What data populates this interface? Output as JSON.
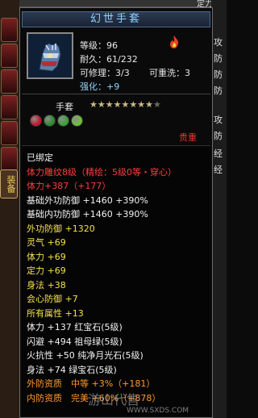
{
  "background": {
    "top_partial": "定力",
    "right_labels": [
      "攻",
      "防",
      "防",
      "防",
      "攻",
      "防",
      "经",
      "经"
    ]
  },
  "equip_tab_label": "装备",
  "item": {
    "name": "幻世手套",
    "level": "等级：96",
    "durability": "耐久：61/232",
    "repair": "可修理：3/3",
    "rewash": "可重洗：3",
    "enhance": "强化：+9",
    "type": "手套",
    "stars_total": 9,
    "stars_lit": 8,
    "gem_colors": [
      "#c4182a",
      "#2e8a2e",
      "#3aa03a",
      "#6bc03a"
    ],
    "precious": "贵重"
  },
  "stats": [
    {
      "text": "已绑定",
      "color": "c-white"
    },
    {
      "text": "体力雕纹8级（精绘：5级0等・穿心）",
      "color": "c-red"
    },
    {
      "text": "体力+387（+177）",
      "color": "c-red"
    },
    {
      "text": "基础外功防御 +1460 +390%",
      "color": "c-white"
    },
    {
      "text": "基础内功防御 +1460 +390%",
      "color": "c-white"
    },
    {
      "text": "外功防御 +1320",
      "color": "c-yellow"
    },
    {
      "text": "灵气 +69",
      "color": "c-yellow"
    },
    {
      "text": "体力 +69",
      "color": "c-yellow"
    },
    {
      "text": "定力 +69",
      "color": "c-yellow"
    },
    {
      "text": "身法 +38",
      "color": "c-yellow"
    },
    {
      "text": "会心防御 +7",
      "color": "c-yellow"
    },
    {
      "text": "所有属性 +13",
      "color": "c-yellow"
    },
    {
      "text": "体力 +137 红宝石(5级)",
      "color": "c-white"
    },
    {
      "text": "闪避 +494 祖母绿(5级)",
      "color": "c-white"
    },
    {
      "text": "火抗性 +50 纯净月光石(5级)",
      "color": "c-white"
    },
    {
      "text": "身法 +74 绿宝石(5级)",
      "color": "c-white"
    },
    {
      "text": "外防资质　中等 +3%（+181）",
      "color": "c-orange"
    },
    {
      "text": "内防资质　完美 +60%（+878）",
      "color": "c-orange"
    }
  ],
  "watermark": {
    "text": "游山代售",
    "url": "WWW.SXDS.COM"
  }
}
